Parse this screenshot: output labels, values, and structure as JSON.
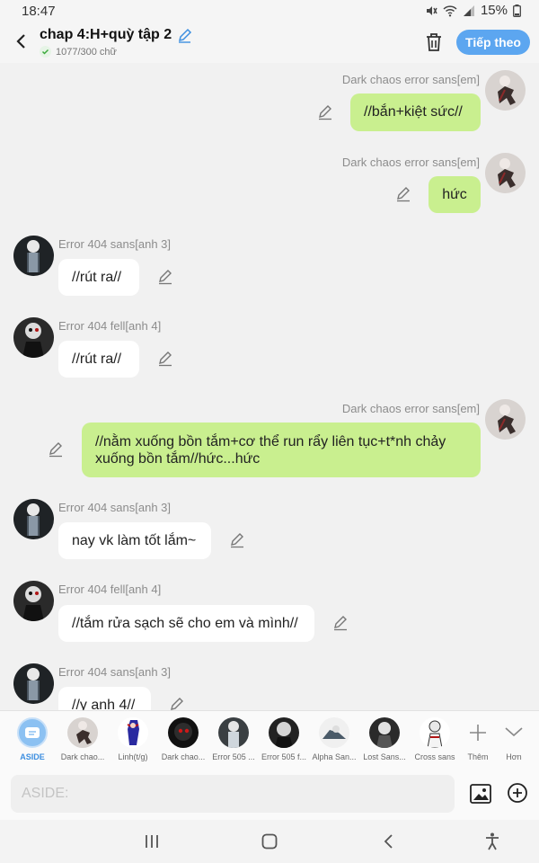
{
  "status": {
    "time": "18:47",
    "battery": "15%"
  },
  "header": {
    "title": "chap 4:H+quỳ tập 2",
    "word_count": "1077/300 chữ",
    "next_button": "Tiếp theo"
  },
  "messages": [
    {
      "side": "right",
      "sender": "Dark chaos error sans[em]",
      "text": "//bắn+kiệt sức//"
    },
    {
      "side": "right",
      "sender": "Dark chaos error sans[em]",
      "text": "hức"
    },
    {
      "side": "left",
      "sender": "Error 404 sans[anh 3]",
      "text": "//rút ra//"
    },
    {
      "side": "left",
      "sender": "Error 404 fell[anh 4]",
      "text": "//rút ra//"
    },
    {
      "side": "right",
      "sender": "Dark chaos error sans[em]",
      "text_lines": [
        "//nằm xuống bồn tắm+cơ thể run rẩy liên tục+t*nh chảy",
        "xuống bồn tắm//hức...hức"
      ]
    },
    {
      "side": "left",
      "sender": "Error 404 sans[anh 3]",
      "text": "nay vk làm tốt lắm~"
    },
    {
      "side": "left",
      "sender": "Error 404 fell[anh 4]",
      "text": "//tắm rửa sạch sẽ cho em và mình//"
    },
    {
      "side": "left",
      "sender": "Error 404 sans[anh 3]",
      "text": "//y anh 4//"
    }
  ],
  "characters": [
    {
      "label": "ASIDE",
      "active": true
    },
    {
      "label": "Dark chao..."
    },
    {
      "label": "Linh(t/g)"
    },
    {
      "label": "Dark chao..."
    },
    {
      "label": "Error 505 ..."
    },
    {
      "label": "Error 505 f..."
    },
    {
      "label": "Alpha San..."
    },
    {
      "label": "Lost Sans..."
    },
    {
      "label": "Cross sans"
    }
  ],
  "actions": {
    "more_label": "Thêm",
    "expand_label": "Hơn"
  },
  "input": {
    "placeholder": "ASIDE:"
  },
  "colors": {
    "accent": "#5ca6f0",
    "bubble_green": "#c9ef8f",
    "bubble_white": "#ffffff"
  }
}
